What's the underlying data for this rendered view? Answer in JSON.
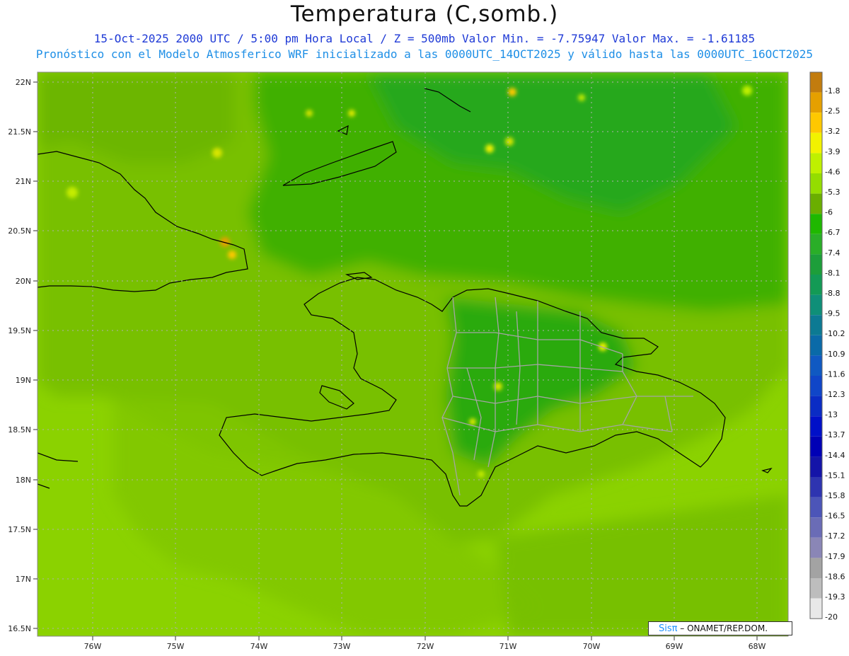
{
  "header": {
    "title": "Temperatura (C,somb.)",
    "line1": "15-Oct-2025  2000 UTC / 5:00 pm Hora Local / Z = 500mb  Valor Min. = -7.75947  Valor Max. = -1.61185",
    "line2": "Pronóstico con el Modelo Atmosferico WRF inicializado a las 0000UTC_14OCT2025 y válido hasta las  0000UTC_16OCT2025"
  },
  "axes": {
    "lat_labels": [
      "22N",
      "21.5N",
      "21N",
      "20.5N",
      "20N",
      "19.5N",
      "19N",
      "18.5N",
      "18N",
      "17.5N",
      "17N",
      "16.5N"
    ],
    "lon_labels": [
      "76W",
      "75W",
      "74W",
      "73W",
      "72W",
      "71W",
      "70W",
      "69W",
      "68W"
    ]
  },
  "colorbar": {
    "labels": [
      "-1.8",
      "-2.5",
      "-3.2",
      "-3.9",
      "-4.6",
      "-5.3",
      "-6",
      "-6.7",
      "-7.4",
      "-8.1",
      "-8.8",
      "-9.5",
      "-10.2",
      "-10.9",
      "-11.6",
      "-12.3",
      "-13",
      "-13.7",
      "-14.4",
      "-15.1",
      "-15.8",
      "-16.5",
      "-17.2",
      "-17.9",
      "-18.6",
      "-19.3",
      "-20"
    ],
    "colors": [
      "#c27c0e",
      "#e5a000",
      "#ffc800",
      "#f2f200",
      "#bff000",
      "#94dd00",
      "#6aae00",
      "#1fb800",
      "#2aae28",
      "#1d9e3a",
      "#139a55",
      "#0f8f78",
      "#0c7a93",
      "#0a6aa8",
      "#1059c2",
      "#1046c8",
      "#0a2cc4",
      "#0010c8",
      "#0000b5",
      "#1414a8",
      "#2e34b0",
      "#4c55b8",
      "#6a6cb6",
      "#8a86b6",
      "#a3a3a3",
      "#bdbdbd",
      "#e8e8e8"
    ]
  },
  "footer": {
    "credit_logo": "Sisπ",
    "credit_text": "– ONAMET/REP.DOM."
  }
}
